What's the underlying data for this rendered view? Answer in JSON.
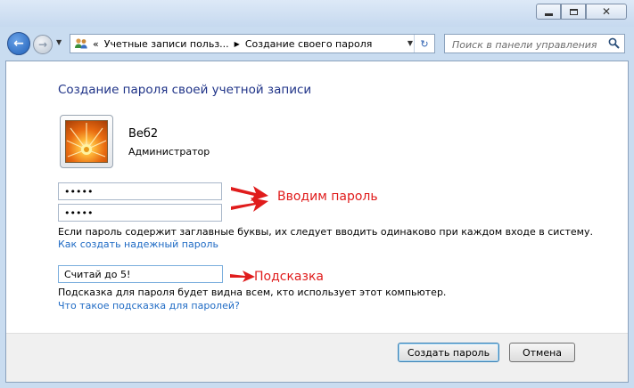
{
  "window": {
    "caption_buttons": [
      "minimize",
      "maximize",
      "close"
    ]
  },
  "navigation": {
    "breadcrumb_prefix": "«",
    "breadcrumb": [
      "Учетные записи польз...",
      "Создание своего пароля"
    ],
    "search_placeholder": "Поиск в панели управления"
  },
  "page": {
    "title": "Создание пароля своей учетной записи",
    "user_name": "Веб2",
    "user_role": "Администратор",
    "password_value": "•••••",
    "confirm_value": "•••••",
    "note_case": "Если пароль содержит заглавные буквы, их следует вводить одинаково при каждом входе в систему.",
    "link_strong_password": "Как создать надежный пароль",
    "hint_value": "Считай до 5!",
    "note_hint": "Подсказка для пароля будет видна всем, кто использует этот компьютер.",
    "link_what_is_hint": "Что такое подсказка для паролей?"
  },
  "annotations": {
    "password_label": "Вводим пароль",
    "hint_label": "Подсказка",
    "color": "#e01c1c"
  },
  "buttons": {
    "create": "Создать пароль",
    "cancel": "Отмена"
  },
  "colors": {
    "title": "#1e3287",
    "link": "#1e6ac4"
  }
}
